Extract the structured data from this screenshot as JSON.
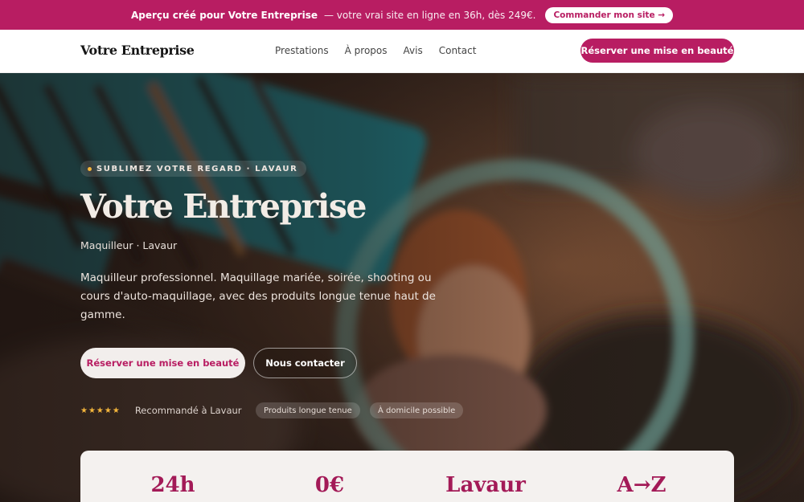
{
  "banner": {
    "lead": "Aperçu créé pour Votre Entreprise",
    "rest": "— votre vrai site en ligne en 36h, dès 249€.",
    "cta": "Commander mon site →"
  },
  "nav": {
    "brand": "Votre Entreprise",
    "items": [
      {
        "label": "Prestations"
      },
      {
        "label": "À propos"
      },
      {
        "label": "Avis"
      },
      {
        "label": "Contact"
      }
    ],
    "cta": "Réserver une mise en beauté"
  },
  "hero": {
    "kicker": "SUBLIMEZ VOTRE REGARD · LAVAUR",
    "title": "Votre Entreprise",
    "subtitle": "Maquilleur · Lavaur",
    "description": "Maquilleur professionnel. Maquillage mariée, soirée, shooting ou cours d'auto-maquillage, avec des produits longue tenue haut de gamme.",
    "primary_cta": "Réserver une mise en beauté",
    "secondary_cta": "Nous contacter",
    "stars": "★★★★★",
    "rating_text": "Recommandé à Lavaur",
    "chips": [
      "Produits longue tenue",
      "À domicile possible"
    ]
  },
  "stats": [
    {
      "value": "24h"
    },
    {
      "value": "0€"
    },
    {
      "value": "Lavaur"
    },
    {
      "value": "A→Z"
    }
  ],
  "colors": {
    "brand": "#b81d62",
    "star": "#f3b53c"
  }
}
